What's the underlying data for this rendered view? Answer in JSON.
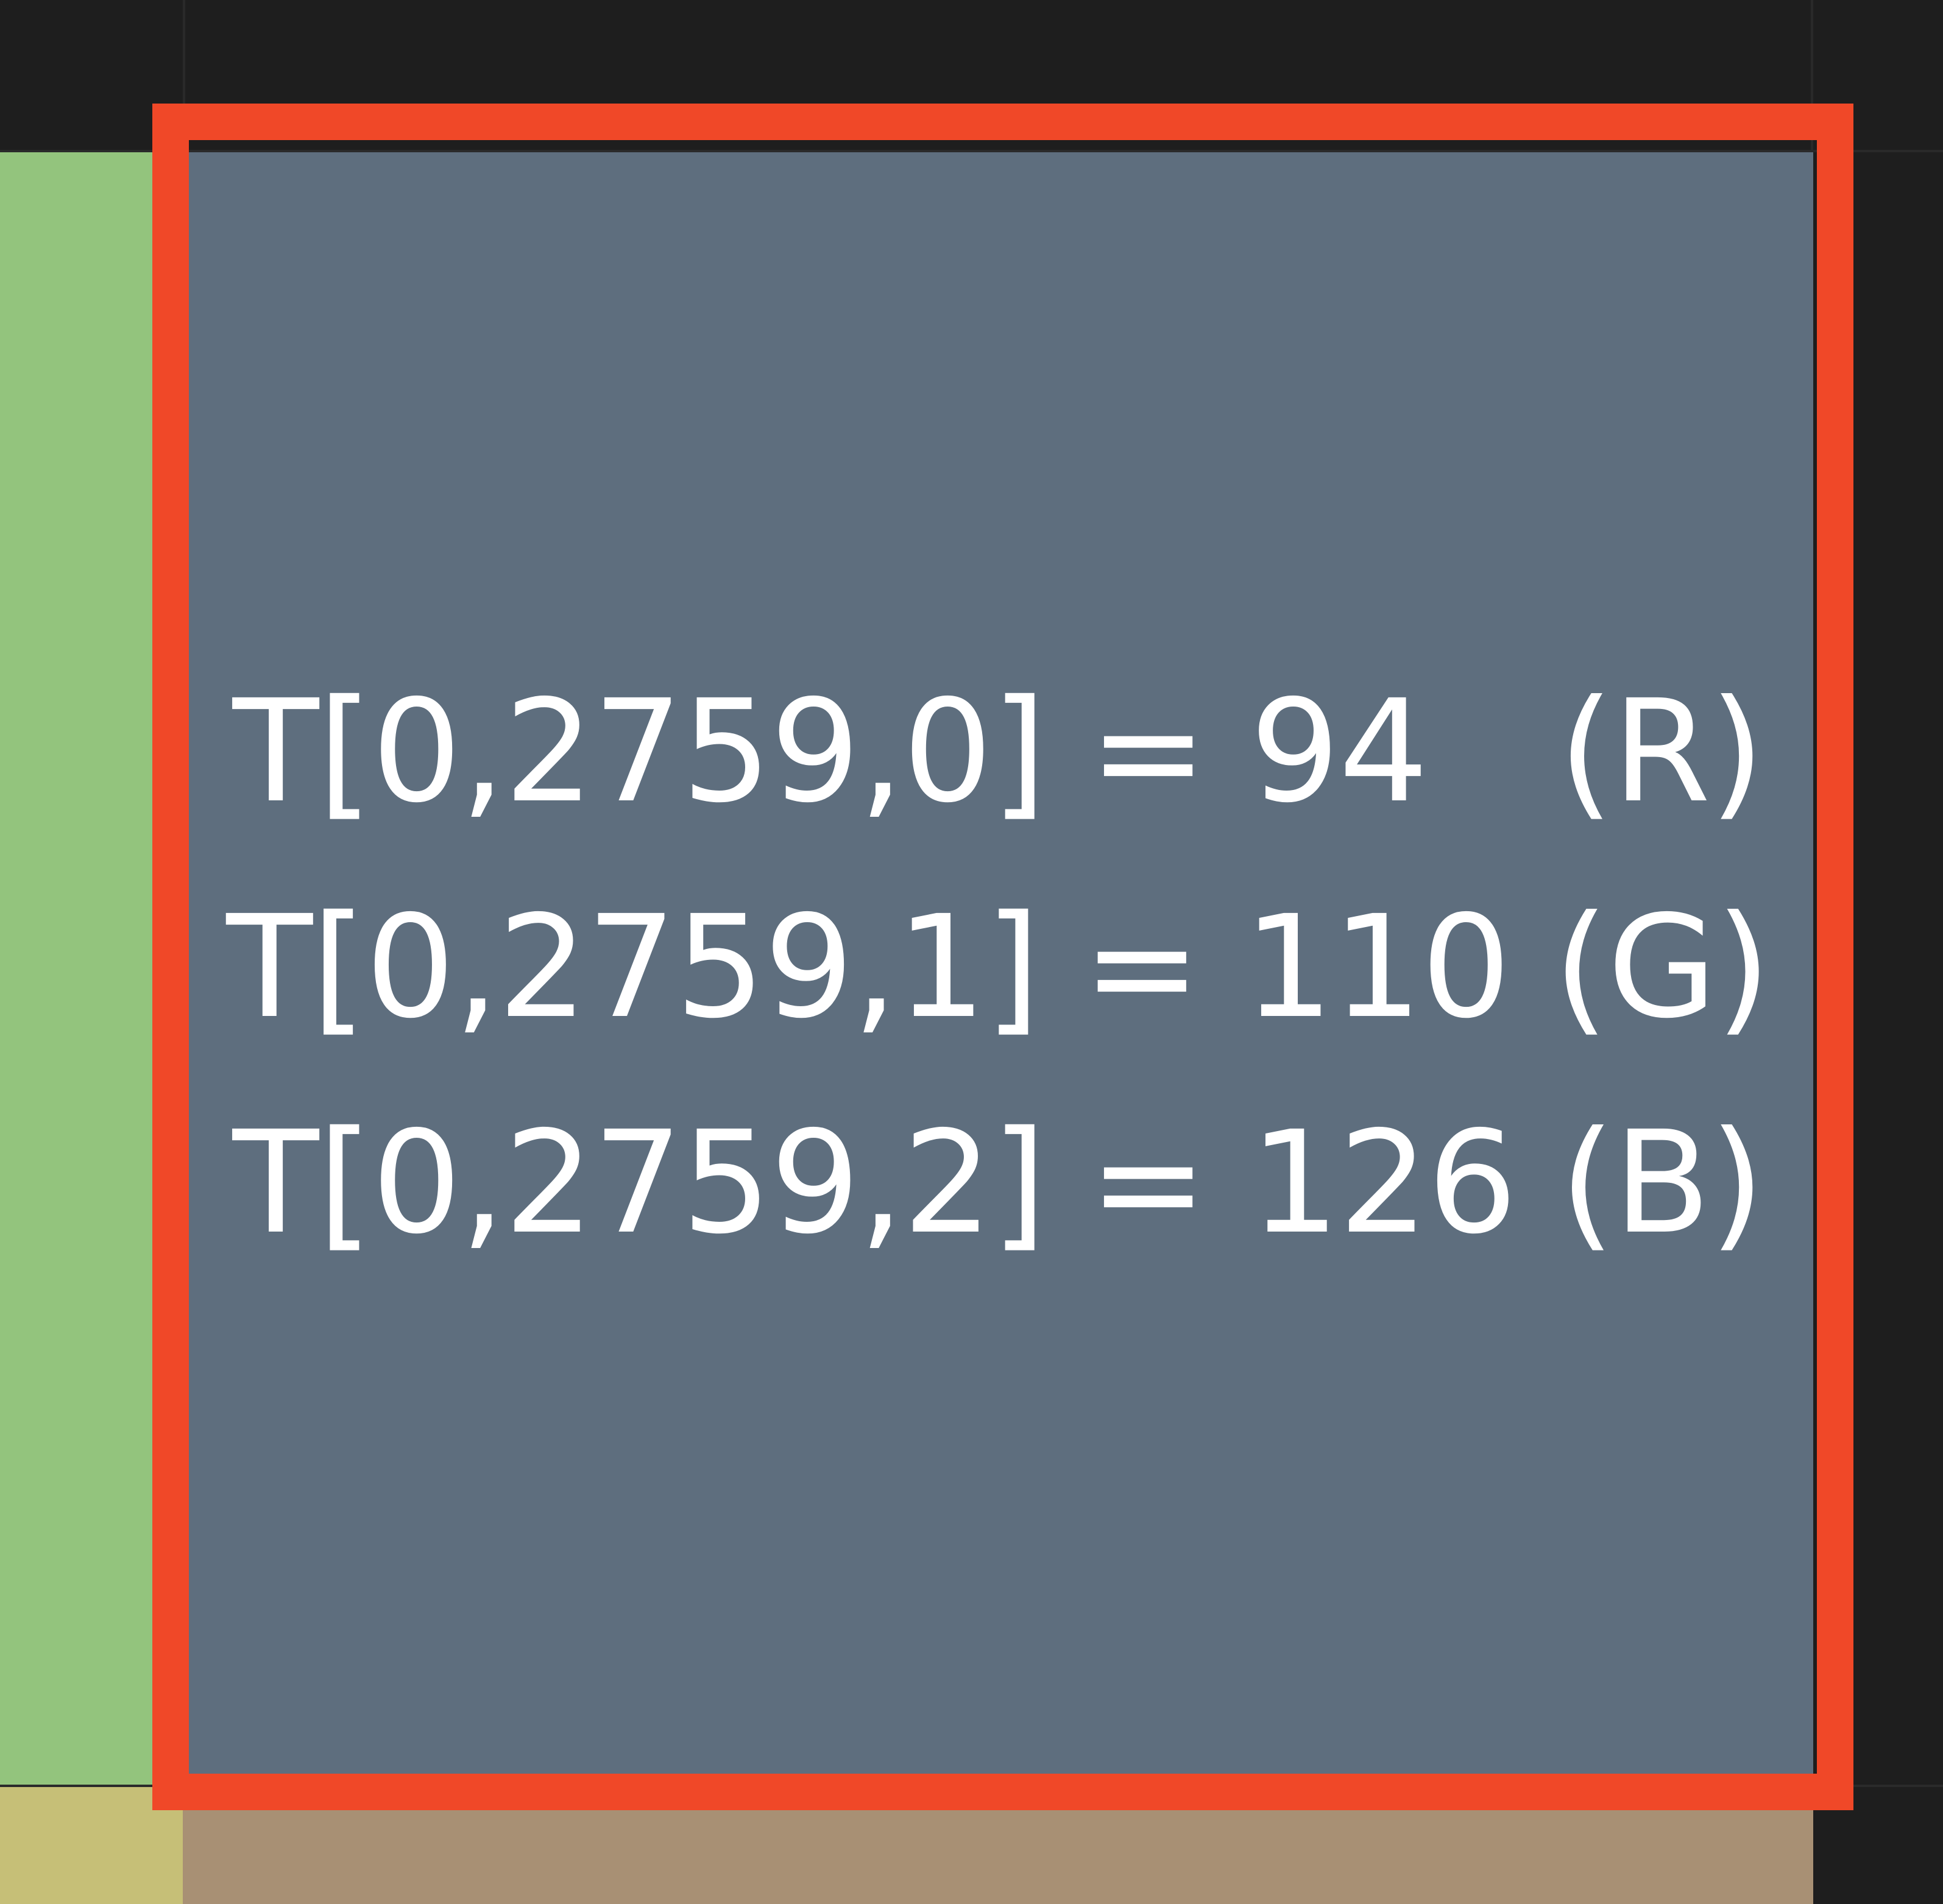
{
  "cells": {
    "top_left": {
      "color": "#1e1e1e"
    },
    "top_mid": {
      "color": "#1e1e1e"
    },
    "top_right": {
      "color": "#1e1e1e"
    },
    "mid_left": {
      "color": "#93c47d"
    },
    "center": {
      "color": "#5e6e7e"
    },
    "mid_right": {
      "color": "#1e1e1e"
    },
    "bot_left": {
      "color": "#c6bf77"
    },
    "bot_mid": {
      "color": "#a89074"
    },
    "bot_right": {
      "color": "#1e1e1e"
    }
  },
  "selection": {
    "border_color": "#f04828"
  },
  "readout": {
    "lines": [
      "T[0,2759,0] = 94   (R)",
      "T[0,2759,1] = 110 (G)",
      "T[0,2759,2] = 126 (B)"
    ],
    "text_color": "#ffffff"
  }
}
